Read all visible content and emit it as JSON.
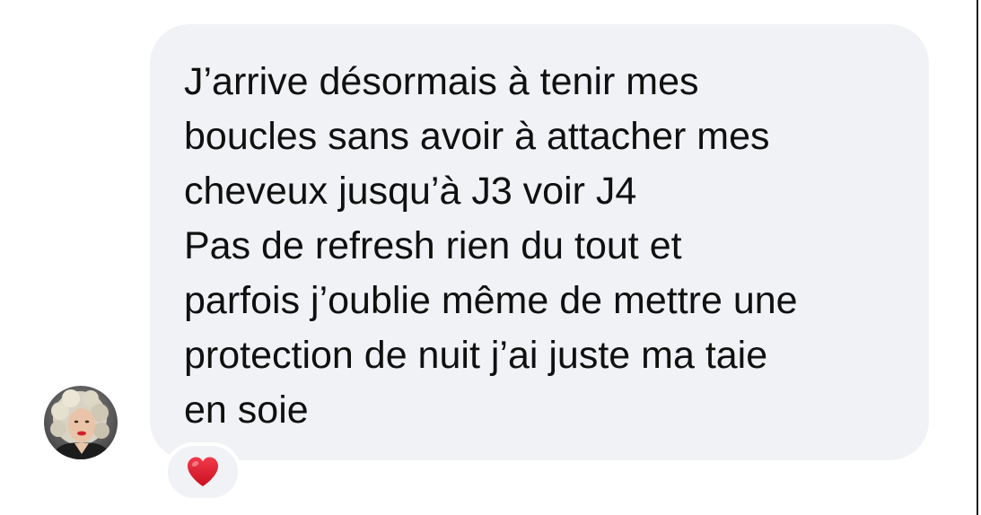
{
  "message": {
    "paragraphs": [
      {
        "lines": [
          "J’arrive désormais à tenir mes",
          "boucles sans avoir à attacher mes",
          "cheveux jusqu’à J3 voir J4"
        ]
      },
      {
        "lines": [
          "Pas de refresh rien du tout et",
          "parfois j’oublie même de mettre une",
          "protection de nuit j’ai juste ma taie",
          "en soie"
        ]
      }
    ],
    "bubble_color": "#f1f2f5",
    "text_color": "#101010"
  },
  "sender": {
    "avatar_icon": "profile-photo"
  },
  "reaction": {
    "icon": "red-heart-icon",
    "color": "#e0182d"
  }
}
